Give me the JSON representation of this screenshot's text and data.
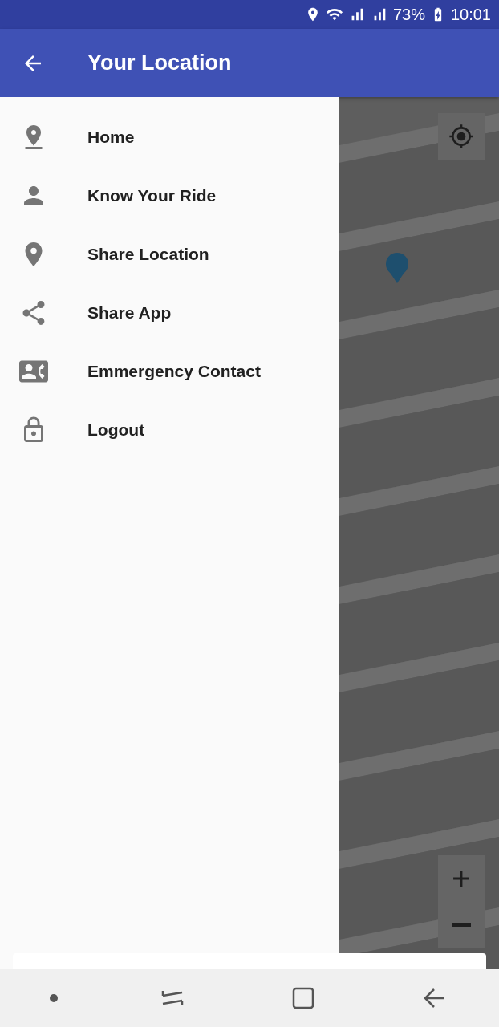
{
  "status_bar": {
    "battery": "73%",
    "time": "10:01"
  },
  "app_bar": {
    "title": "Your Location"
  },
  "drawer": {
    "items": [
      {
        "label": "Home"
      },
      {
        "label": "Know Your Ride"
      },
      {
        "label": "Share Location"
      },
      {
        "label": "Share App"
      },
      {
        "label": "Emmergency Contact"
      },
      {
        "label": "Logout"
      }
    ]
  }
}
